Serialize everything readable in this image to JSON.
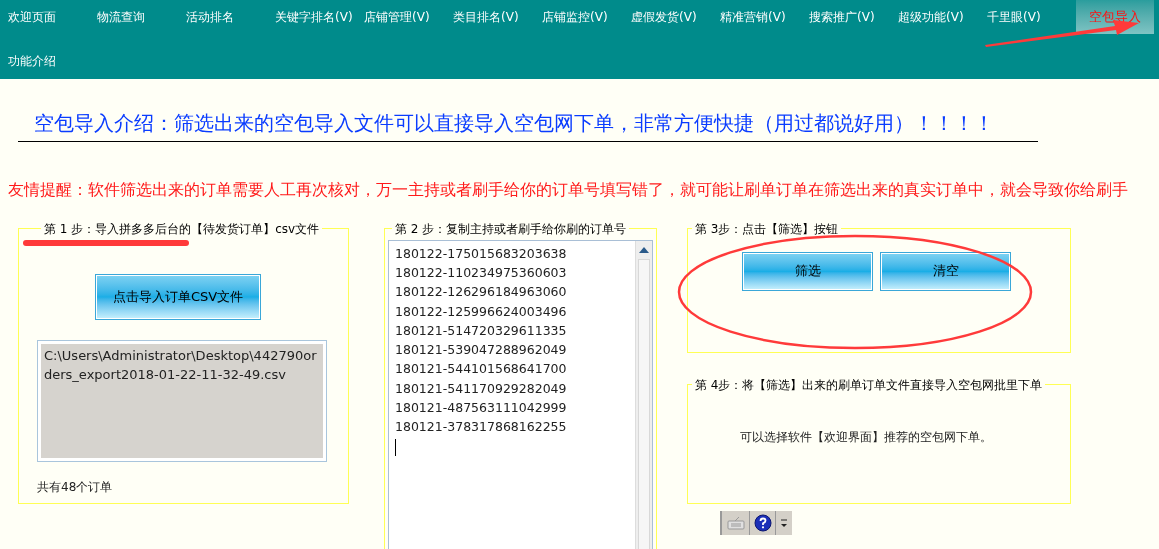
{
  "nav": {
    "items": [
      {
        "label": "欢迎页面",
        "selected": false
      },
      {
        "label": "物流查询",
        "selected": false
      },
      {
        "label": "活动排名",
        "selected": false
      },
      {
        "label": "关键字排名(V)",
        "selected": false
      },
      {
        "label": "店铺管理(V)",
        "selected": false
      },
      {
        "label": "类目排名(V)",
        "selected": false
      },
      {
        "label": "店铺监控(V)",
        "selected": false
      },
      {
        "label": "虚假发货(V)",
        "selected": false
      },
      {
        "label": "精准营销(V)",
        "selected": false
      },
      {
        "label": "搜索推广(V)",
        "selected": false
      },
      {
        "label": "超级功能(V)",
        "selected": false
      },
      {
        "label": "千里眼(V)",
        "selected": false
      },
      {
        "label": "空包导入",
        "selected": true
      }
    ],
    "second_row": [
      {
        "label": "功能介绍",
        "selected": false
      }
    ]
  },
  "intro": "空包导入介绍：筛选出来的空包导入文件可以直接导入空包网下单，非常方便快捷（用过都说好用）！！！！",
  "notice": "友情提醒：软件筛选出来的订单需要人工再次核对，万一主持或者刷手给你的订单号填写错了，就可能让刷单订单在筛选出来的真实订单中，就会导致你给刷手",
  "steps": [
    {
      "kind": "import",
      "legend": "第 1 步：导入拼多多后台的【待发货订单】csv文件",
      "button": "点击导入订单CSV文件",
      "file_path": "C:\\Users\\Administrator\\Desktop\\442790orders_export2018-01-22-11-32-49.csv",
      "count": "共有48个订单"
    },
    {
      "kind": "orders",
      "legend": "第 2 步：复制主持或者刷手给你刷的订单号",
      "orders": [
        "180122-175015683203638",
        "180122-110234975360603",
        "180122-126296184963060",
        "180122-125996624003496",
        "180121-514720329611335",
        "180121-539047288962049",
        "180121-544101568641700",
        "180121-541170929282049",
        "180121-487563111042999",
        "180121-378317868162255"
      ]
    },
    {
      "kind": "buttons",
      "legend": "第 3步：点击【筛选】按钮",
      "buttons": [
        "筛选",
        "清空"
      ]
    },
    {
      "kind": "note",
      "legend": "第 4步：将【筛选】出来的刷单订单文件直接导入空包网批里下单",
      "text": "可以选择软件【欢迎界面】推荐的空包网下单。"
    }
  ]
}
